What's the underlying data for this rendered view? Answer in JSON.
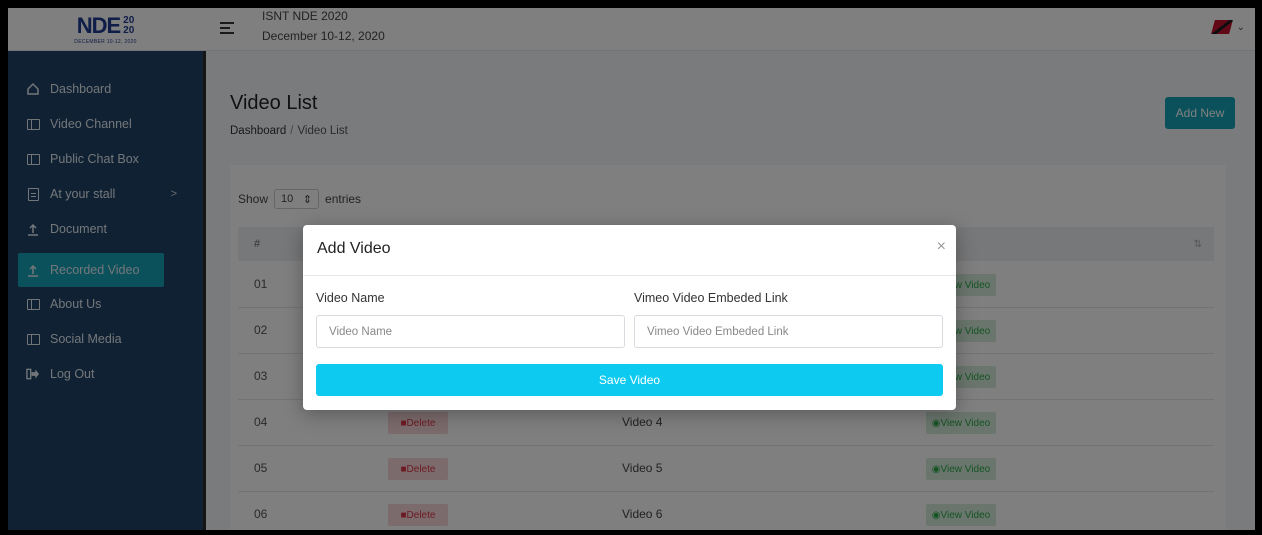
{
  "header": {
    "logo_text": "NDE",
    "logo_year_top": "20",
    "logo_year_bottom": "20",
    "logo_sub": "DECEMBER 10-12, 2020",
    "event_title": "ISNT NDE 2020",
    "event_date": "December 10-12, 2020",
    "user_menu_icon": "chevron-down-icon"
  },
  "sidebar": {
    "items": [
      {
        "label": "Dashboard",
        "icon": "home-icon"
      },
      {
        "label": "Video Channel",
        "icon": "window-icon"
      },
      {
        "label": "Public Chat Box",
        "icon": "window-icon"
      },
      {
        "label": "At your stall",
        "icon": "document-icon",
        "arrow": ">"
      },
      {
        "label": "Document",
        "icon": "upload-icon"
      },
      {
        "label": "Recorded Video",
        "icon": "upload-icon",
        "active": true
      },
      {
        "label": "About Us",
        "icon": "window-icon"
      },
      {
        "label": "Social Media",
        "icon": "window-icon"
      },
      {
        "label": "Log Out",
        "icon": "logout-icon"
      }
    ]
  },
  "main": {
    "page_title": "Video List",
    "breadcrumb": {
      "home": "Dashboard",
      "sep": "/",
      "current": "Video List"
    },
    "add_new_label": "Add New",
    "show_label": "Show",
    "entries_value": "10",
    "entries_label": "entries",
    "table": {
      "header_num": "#",
      "rows": [
        {
          "num": "01",
          "name": "",
          "delete": "",
          "view": "View Video"
        },
        {
          "num": "02",
          "name": "",
          "delete": "",
          "view": "View Video"
        },
        {
          "num": "03",
          "name": "",
          "delete": "",
          "view": "View Video"
        },
        {
          "num": "04",
          "name": "Video 4",
          "delete": "Delete",
          "view": "View Video"
        },
        {
          "num": "05",
          "name": "Video 5",
          "delete": "Delete",
          "view": "View Video"
        },
        {
          "num": "06",
          "name": "Video 6",
          "delete": "Delete",
          "view": "View Video"
        }
      ]
    }
  },
  "modal": {
    "title": "Add Video",
    "close": "×",
    "video_name_label": "Video Name",
    "video_name_placeholder": "Video Name",
    "vimeo_label": "Vimeo Video Embeded Link",
    "vimeo_placeholder": "Vimeo Video Embeded Link",
    "save_label": "Save Video"
  },
  "colors": {
    "sidebar_bg": "#1e4266",
    "accent": "#17a2b8",
    "save_button": "#0dcaf0",
    "delete_text": "#dc3545",
    "view_text": "#28a745"
  }
}
